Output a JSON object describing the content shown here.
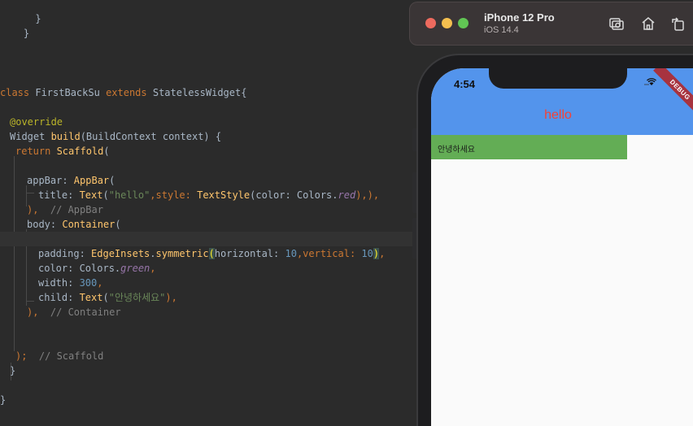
{
  "editor": {
    "lines": {
      "l1": "  }",
      "l2": "}",
      "l3_a": "class ",
      "l3_b": "FirstBackSu ",
      "l3_c": "extends ",
      "l3_d": "StatelessWidget{",
      "l4": "@override",
      "l5_a": "Widget ",
      "l5_b": "build",
      "l5_c": "(BuildContext context) {",
      "l6_a": "return ",
      "l6_b": "Scaffold",
      "l6_c": "(",
      "l7_a": "appBar: ",
      "l7_b": "AppBar",
      "l7_c": "(",
      "l8_a": "title: ",
      "l8_b": "Text",
      "l8_c": "(",
      "l8_d": "\"hello\"",
      "l8_e": ",style: ",
      "l8_f": "TextStyle",
      "l8_g": "(color: Colors.",
      "l8_h": "red",
      "l8_i": "),",
      "l8_j": "),",
      "l9_a": "),  ",
      "l9_b": "// AppBar",
      "l10_a": "body: ",
      "l10_b": "Container",
      "l10_c": "(",
      "l11_a": "padding: ",
      "l11_b": "EdgeInsets",
      "l11_c": ".",
      "l11_d": "symmetric",
      "l11_e": "(",
      "l11_f": "horizontal: ",
      "l11_g": "10",
      "l11_h": ",vertical: ",
      "l11_i": "10",
      "l11_j": ")",
      "l11_k": ",",
      "l12_a": "color: Colors.",
      "l12_b": "green",
      "l12_c": ",",
      "l13_a": "width: ",
      "l13_b": "300",
      "l13_c": ",",
      "l14_a": "child: ",
      "l14_b": "Text",
      "l14_c": "(",
      "l14_d": "\"안녕하세요\"",
      "l14_e": "),",
      "l15_a": "),  ",
      "l15_b": "// Container",
      "l16_a": ");  ",
      "l16_b": "// Scaffold",
      "l17": "}",
      "l18": "}"
    }
  },
  "simulator": {
    "device_name": "iPhone 12 Pro",
    "os_version": "iOS 14.4",
    "toolbar_icons": [
      "screenshot-icon",
      "home-icon",
      "rotate-icon"
    ]
  },
  "phone": {
    "clock": "4:54",
    "appbar_title": "hello",
    "debug_banner": "DEBUG",
    "body_text": "안녕하세요"
  },
  "colors": {
    "appbar": "#5394ec",
    "title_text": "#f44336",
    "container": "#63ad55",
    "editor_bg": "#2b2b2b"
  }
}
